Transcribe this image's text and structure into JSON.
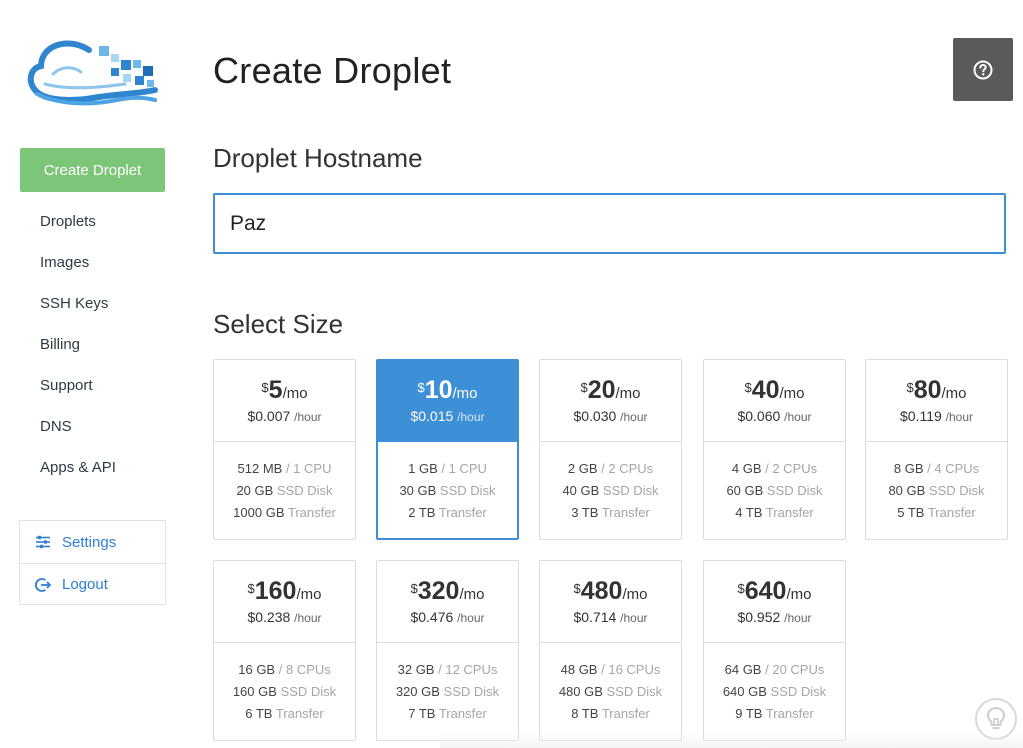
{
  "sidebar": {
    "create_button": "Create Droplet",
    "nav": [
      "Droplets",
      "Images",
      "SSH Keys",
      "Billing",
      "Support",
      "DNS",
      "Apps & API"
    ],
    "settings": "Settings",
    "logout": "Logout"
  },
  "main": {
    "title": "Create Droplet",
    "hostname_heading": "Droplet Hostname",
    "hostname_value": "Paz",
    "size_heading": "Select Size"
  },
  "sizes": [
    {
      "cur": "$",
      "amount": "5",
      "per": "/mo",
      "hourly": "$0.007",
      "hr": "/hour",
      "mem": "512 MB",
      "cpu": "/ 1 CPU",
      "disk": "20 GB",
      "disk_label": "SSD Disk",
      "transfer": "1000 GB",
      "transfer_label": "Transfer"
    },
    {
      "cur": "$",
      "amount": "10",
      "per": "/mo",
      "hourly": "$0.015",
      "hr": "/hour",
      "mem": "1 GB",
      "cpu": "/ 1 CPU",
      "disk": "30 GB",
      "disk_label": "SSD Disk",
      "transfer": "2 TB",
      "transfer_label": "Transfer",
      "selected": true
    },
    {
      "cur": "$",
      "amount": "20",
      "per": "/mo",
      "hourly": "$0.030",
      "hr": "/hour",
      "mem": "2 GB",
      "cpu": "/ 2 CPUs",
      "disk": "40 GB",
      "disk_label": "SSD Disk",
      "transfer": "3 TB",
      "transfer_label": "Transfer"
    },
    {
      "cur": "$",
      "amount": "40",
      "per": "/mo",
      "hourly": "$0.060",
      "hr": "/hour",
      "mem": "4 GB",
      "cpu": "/ 2 CPUs",
      "disk": "60 GB",
      "disk_label": "SSD Disk",
      "transfer": "4 TB",
      "transfer_label": "Transfer"
    },
    {
      "cur": "$",
      "amount": "80",
      "per": "/mo",
      "hourly": "$0.119",
      "hr": "/hour",
      "mem": "8 GB",
      "cpu": "/ 4 CPUs",
      "disk": "80 GB",
      "disk_label": "SSD Disk",
      "transfer": "5 TB",
      "transfer_label": "Transfer"
    },
    {
      "cur": "$",
      "amount": "160",
      "per": "/mo",
      "hourly": "$0.238",
      "hr": "/hour",
      "mem": "16 GB",
      "cpu": "/ 8 CPUs",
      "disk": "160 GB",
      "disk_label": "SSD Disk",
      "transfer": "6 TB",
      "transfer_label": "Transfer"
    },
    {
      "cur": "$",
      "amount": "320",
      "per": "/mo",
      "hourly": "$0.476",
      "hr": "/hour",
      "mem": "32 GB",
      "cpu": "/ 12 CPUs",
      "disk": "320 GB",
      "disk_label": "SSD Disk",
      "transfer": "7 TB",
      "transfer_label": "Transfer"
    },
    {
      "cur": "$",
      "amount": "480",
      "per": "/mo",
      "hourly": "$0.714",
      "hr": "/hour",
      "mem": "48 GB",
      "cpu": "/ 16 CPUs",
      "disk": "480 GB",
      "disk_label": "SSD Disk",
      "transfer": "8 TB",
      "transfer_label": "Transfer"
    },
    {
      "cur": "$",
      "amount": "640",
      "per": "/mo",
      "hourly": "$0.952",
      "hr": "/hour",
      "mem": "64 GB",
      "cpu": "/ 20 CPUs",
      "disk": "640 GB",
      "disk_label": "SSD Disk",
      "transfer": "9 TB",
      "transfer_label": "Transfer"
    }
  ],
  "icons": {
    "logo": "cloud-logo-icon",
    "help": "help-circle-icon",
    "settings": "sliders-icon",
    "logout": "logout-icon",
    "tips": "lightbulb-icon"
  },
  "colors": {
    "accent": "#3d8fd6",
    "create_button": "#7dc679",
    "help_button": "#5a5a5a",
    "link": "#2f7fd6"
  }
}
